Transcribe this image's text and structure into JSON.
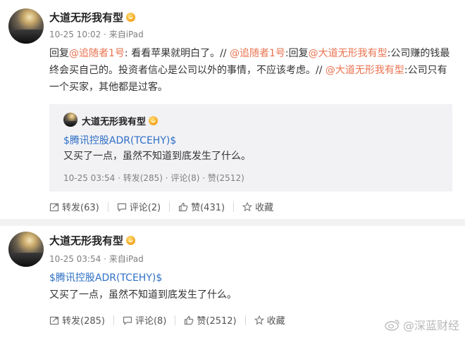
{
  "post1": {
    "author": "大道无形我有型",
    "meta": "10-25 10:02 · 来自iPad",
    "text_parts": [
      {
        "t": "回复",
        "c": "plain"
      },
      {
        "t": "@追随者1号",
        "c": "link"
      },
      {
        "t": ": 看看苹果就明白了。// ",
        "c": "plain"
      },
      {
        "t": "@追随者1号",
        "c": "link"
      },
      {
        "t": ":回复",
        "c": "plain"
      },
      {
        "t": "@大道无形我有型",
        "c": "link"
      },
      {
        "t": ":公司赚的钱最终会买自己的。投资者信心是公司以外的事情，不应该考虑。// ",
        "c": "plain"
      },
      {
        "t": "@大道无形我有型",
        "c": "link"
      },
      {
        "t": ":公司只有一个买家，其他都是过客。",
        "c": "plain"
      }
    ],
    "repost": {
      "author": "大道无形我有型",
      "stock_tag": "$腾讯控股ADR(TCEHY)$",
      "text": "又买了一点，虽然不知道到底发生了什么。",
      "meta": "10-25 03:54 · 转发(285) · 评论(8) · 赞(2512)"
    },
    "actions": {
      "repost": "转发(63)",
      "comment": "评论(2)",
      "like": "赞(431)",
      "favorite": "收藏"
    }
  },
  "post2": {
    "author": "大道无形我有型",
    "meta": "10-25 03:54 · 来自iPad",
    "stock_tag": "$腾讯控股ADR(TCEHY)$",
    "text": "又买了一点，虽然不知道到底发生了什么。",
    "actions": {
      "repost": "转发(285)",
      "comment": "评论(8)",
      "like": "赞(2512)",
      "favorite": "收藏"
    }
  },
  "watermark": "@深蓝财经",
  "colors": {
    "link": "#eb7350",
    "stock": "#2e6fc5"
  }
}
